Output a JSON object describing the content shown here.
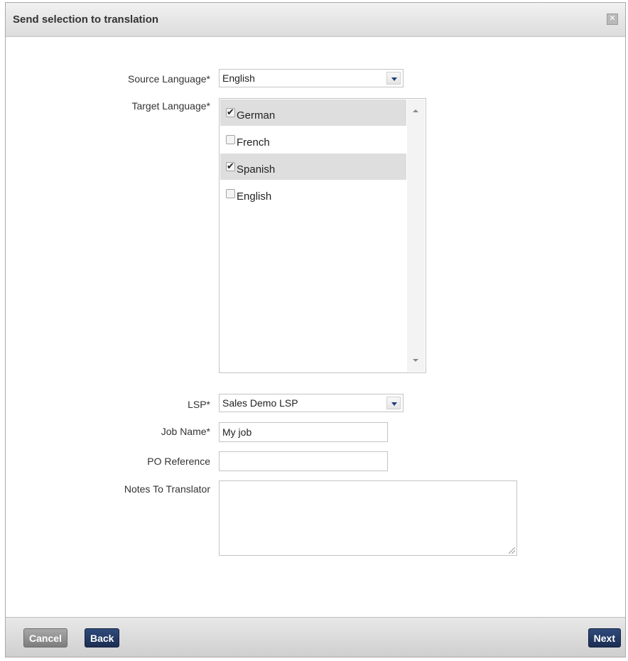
{
  "dialog": {
    "title": "Send selection to translation",
    "close_icon": "close-icon"
  },
  "form": {
    "source_language": {
      "label": "Source Language*",
      "value": "English"
    },
    "target_language": {
      "label": "Target Language*",
      "options": [
        {
          "label": "German",
          "checked": true
        },
        {
          "label": "French",
          "checked": false
        },
        {
          "label": "Spanish",
          "checked": true
        },
        {
          "label": "English",
          "checked": false
        }
      ]
    },
    "lsp": {
      "label": "LSP*",
      "value": "Sales Demo LSP"
    },
    "job_name": {
      "label": "Job Name*",
      "value": "My job"
    },
    "po_reference": {
      "label": "PO Reference",
      "value": ""
    },
    "notes": {
      "label": "Notes To Translator",
      "value": ""
    }
  },
  "footer": {
    "cancel_label": "Cancel",
    "back_label": "Back",
    "next_label": "Next"
  },
  "colors": {
    "primary_button": "#1f335c",
    "secondary_button": "#8c8c8c",
    "selected_row": "#dedede"
  }
}
